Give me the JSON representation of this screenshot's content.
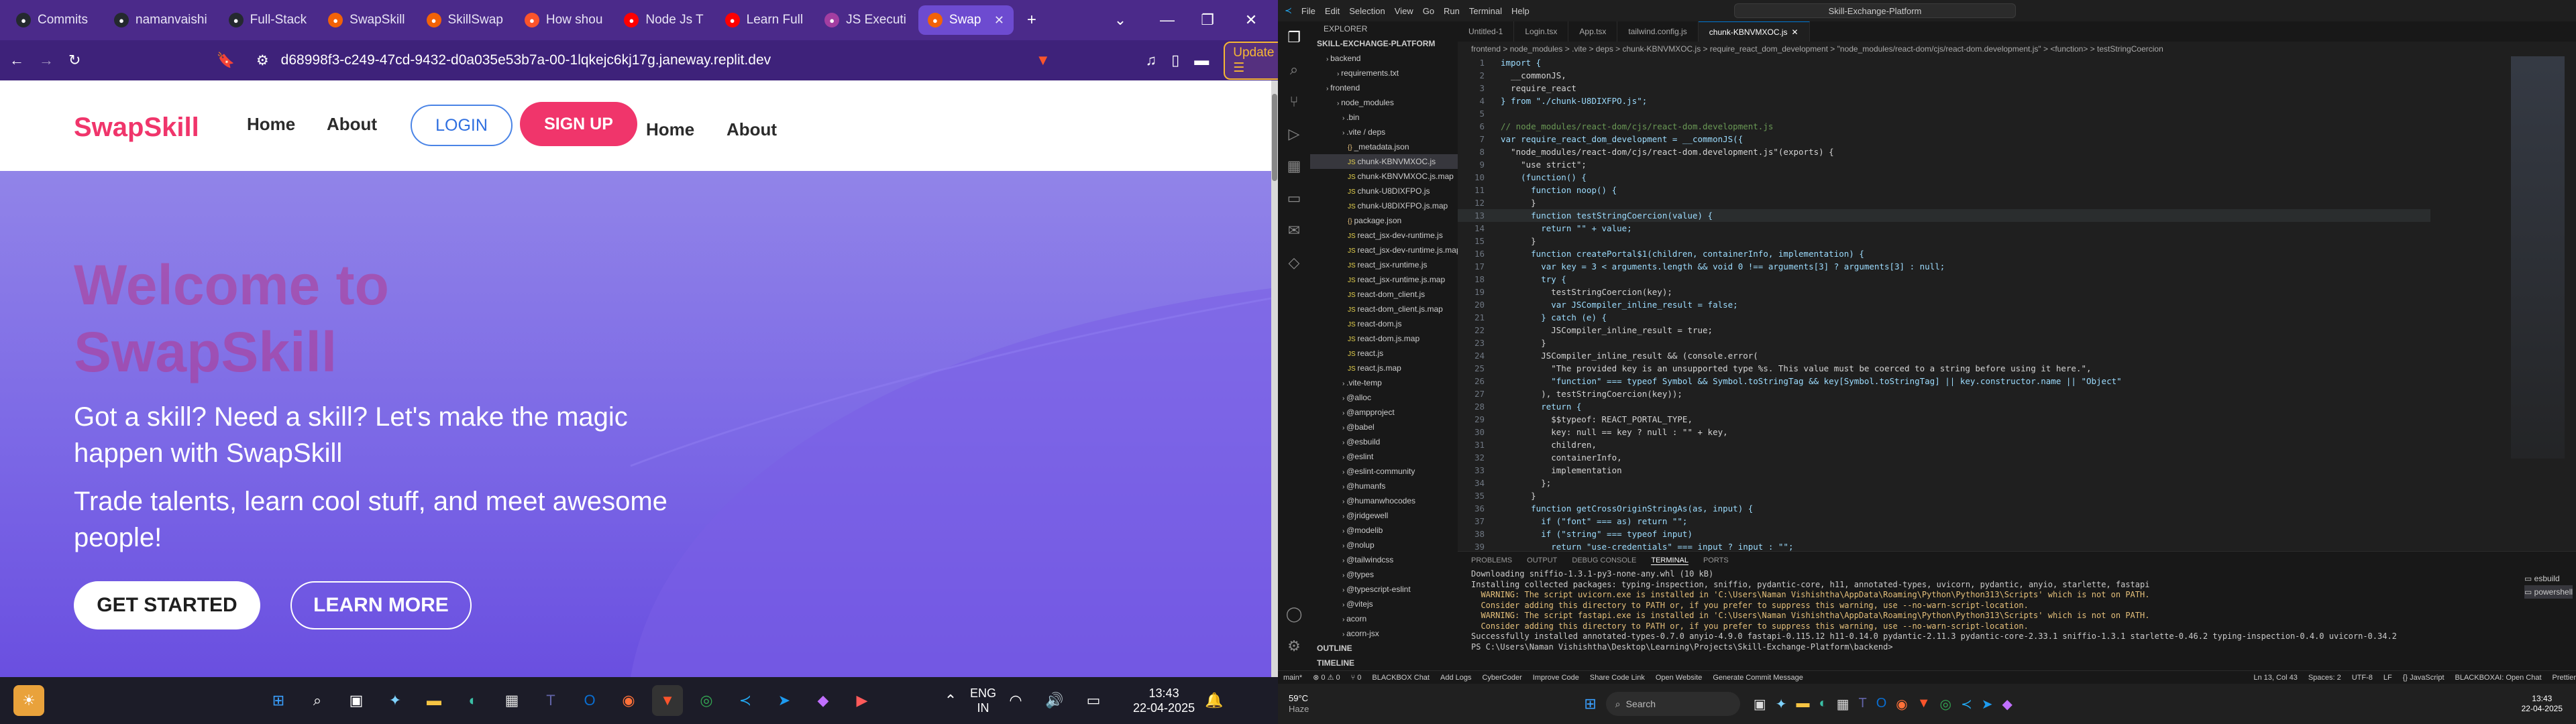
{
  "browser": {
    "tabs": [
      {
        "label": "Commits",
        "icon": "github-icon",
        "color": "#24292f"
      },
      {
        "label": "namanvaishi",
        "icon": "github-icon",
        "color": "#24292f"
      },
      {
        "label": "Full-Stack",
        "icon": "github-icon",
        "color": "#24292f"
      },
      {
        "label": "SwapSkill",
        "icon": "replit-icon",
        "color": "#f26207"
      },
      {
        "label": "SkillSwap",
        "icon": "replit-icon",
        "color": "#f26207"
      },
      {
        "label": "How shou",
        "icon": "brave-icon",
        "color": "#fb542b"
      },
      {
        "label": "Node Js T",
        "icon": "youtube-icon",
        "color": "#ff0000"
      },
      {
        "label": "Learn Full",
        "icon": "youtube-icon",
        "color": "#ff0000"
      },
      {
        "label": "JS Executi",
        "icon": "tool-icon",
        "color": "#a33ea1"
      },
      {
        "label": "Swap",
        "icon": "replit-icon",
        "color": "#f26207",
        "active": true
      }
    ],
    "url": "d68998f3-c249-47cd-9432-d0a035e53b7a-00-1lqkejc6kj17g.janeway.replit.dev",
    "update_label": "Update"
  },
  "site": {
    "logo": "SwapSkill",
    "nav": {
      "home": "Home",
      "about": "About",
      "login": "LOGIN",
      "signup": "SIGN UP",
      "home2": "Home",
      "about2": "About"
    },
    "hero": {
      "title": "Welcome to SwapSkill",
      "line1": "Got a skill? Need a skill? Let's make the magic happen with SwapSkill",
      "line2": "Trade talents, learn cool stuff, and meet awesome people!",
      "cta_primary": "GET STARTED",
      "cta_secondary": "LEARN MORE"
    }
  },
  "taskbar_left": {
    "lang": "ENG",
    "region": "IN",
    "time": "13:43",
    "date": "22-04-2025"
  },
  "vscode": {
    "menu": [
      "File",
      "Edit",
      "Selection",
      "View",
      "Go",
      "Run",
      "Terminal",
      "Help"
    ],
    "search": "Skill-Exchange-Platform",
    "explorer_title": "EXPLORER",
    "project": "SKILL-EXCHANGE-PLATFORM",
    "files": [
      "backend",
      "requirements.txt",
      "frontend",
      "node_modules",
      ".bin",
      ".vite / deps",
      "_metadata.json",
      "chunk-KBNVMXOC.js",
      "chunk-KBNVMXOC.js.map",
      "chunk-U8DIXFPO.js",
      "chunk-U8DIXFPO.js.map",
      "package.json",
      "react_jsx-dev-runtime.js",
      "react_jsx-dev-runtime.js.map",
      "react_jsx-runtime.js",
      "react_jsx-runtime.js.map",
      "react-dom_client.js",
      "react-dom_client.js.map",
      "react-dom.js",
      "react-dom.js.map",
      "react.js",
      "react.js.map",
      ".vite-temp",
      "@alloc",
      "@ampproject",
      "@babel",
      "@esbuild",
      "@eslint",
      "@eslint-community",
      "@humanfs",
      "@humanwhocodes",
      "@jridgewell",
      "@modelib",
      "@nolup",
      "@tailwindcss",
      "@types",
      "@typescript-eslint",
      "@vitejs",
      "acorn",
      "acorn-jsx"
    ],
    "outline": "OUTLINE",
    "timeline": "TIMELINE",
    "editor_tabs": [
      "Untitled-1",
      "Login.tsx",
      "App.tsx",
      "tailwind.config.js",
      "chunk-KBNVMXOC.js"
    ],
    "breadcrumb": "frontend > node_modules > .vite > deps > chunk-KBNVMXOC.js > require_react_dom_development > \"node_modules/react-dom/cjs/react-dom.development.js\" > <function> > testStringCoercion",
    "code": [
      "import {",
      "  __commonJS,",
      "  require_react",
      "} from \"./chunk-U8DIXFPO.js\";",
      "",
      "// node_modules/react-dom/cjs/react-dom.development.js",
      "var require_react_dom_development = __commonJS({",
      "  \"node_modules/react-dom/cjs/react-dom.development.js\"(exports) {",
      "    \"use strict\";",
      "    (function() {",
      "      function noop() {",
      "      }",
      "      function testStringCoercion(value) {",
      "        return \"\" + value;",
      "      }",
      "      function createPortal$1(children, containerInfo, implementation) {",
      "        var key = 3 < arguments.length && void 0 !== arguments[3] ? arguments[3] : null;",
      "        try {",
      "          testStringCoercion(key);",
      "          var JSCompiler_inline_result = false;",
      "        } catch (e) {",
      "          JSCompiler_inline_result = true;",
      "        }",
      "        JSCompiler_inline_result && (console.error(",
      "          \"The provided key is an unsupported type %s. This value must be coerced to a string before using it here.\",",
      "          \"function\" === typeof Symbol && Symbol.toStringTag && key[Symbol.toStringTag] || key.constructor.name || \"Object\"",
      "        ), testStringCoercion(key));",
      "        return {",
      "          $$typeof: REACT_PORTAL_TYPE,",
      "          key: null == key ? null : \"\" + key,",
      "          children,",
      "          containerInfo,",
      "          implementation",
      "        };",
      "      }",
      "      function getCrossOriginStringAs(as, input) {",
      "        if (\"font\" === as) return \"\";",
      "        if (\"string\" === typeof input)",
      "          return \"use-credentials\" === input ? input : \"\";"
    ],
    "panel_tabs": [
      "PROBLEMS",
      "OUTPUT",
      "DEBUG CONSOLE",
      "TERMINAL",
      "PORTS"
    ],
    "terminal": [
      {
        "t": "Downloading sniffio-1.3.1-py3-none-any.whl (10 kB)",
        "w": false
      },
      {
        "t": "Installing collected packages: typing-inspection, sniffio, pydantic-core, h11, annotated-types, uvicorn, pydantic, anyio, starlette, fastapi",
        "w": false
      },
      {
        "t": "  WARNING: The script uvicorn.exe is installed in 'C:\\Users\\Naman Vishishtha\\AppData\\Roaming\\Python\\Python313\\Scripts' which is not on PATH.",
        "w": true
      },
      {
        "t": "  Consider adding this directory to PATH or, if you prefer to suppress this warning, use --no-warn-script-location.",
        "w": true
      },
      {
        "t": "  WARNING: The script fastapi.exe is installed in 'C:\\Users\\Naman Vishishtha\\AppData\\Roaming\\Python\\Python313\\Scripts' which is not on PATH.",
        "w": true
      },
      {
        "t": "  Consider adding this directory to PATH or, if you prefer to suppress this warning, use --no-warn-script-location.",
        "w": true
      },
      {
        "t": "Successfully installed annotated-types-0.7.0 anyio-4.9.0 fastapi-0.115.12 h11-0.14.0 pydantic-2.11.3 pydantic-core-2.33.1 sniffio-1.3.1 starlette-0.46.2 typing-inspection-0.4.0 uvicorn-0.34.2",
        "w": false
      },
      {
        "t": "PS C:\\Users\\Naman Vishishtha\\Desktop\\Learning\\Projects\\Skill-Exchange-Platform\\backend> ",
        "w": false
      }
    ],
    "terminals": [
      "esbuild",
      "powershell"
    ],
    "status": [
      "main*",
      "⊗ 0 ⚠ 0",
      "⑂ 0",
      "BLACKBOX Chat",
      "Add Logs",
      "CyberCoder",
      "Improve Code",
      "Share Code Link",
      "Open Website",
      "Generate Commit Message",
      "Ln 13, Col 43",
      "Spaces: 2",
      "UTF-8",
      "LF",
      "{} JavaScript",
      "BLACKBOXAI: Open Chat",
      "Prettier"
    ]
  },
  "taskbar_right": {
    "weather_temp": "59°C",
    "weather_label": "Haze",
    "search": "Search",
    "time": "13:43",
    "date": "22-04-2025"
  }
}
